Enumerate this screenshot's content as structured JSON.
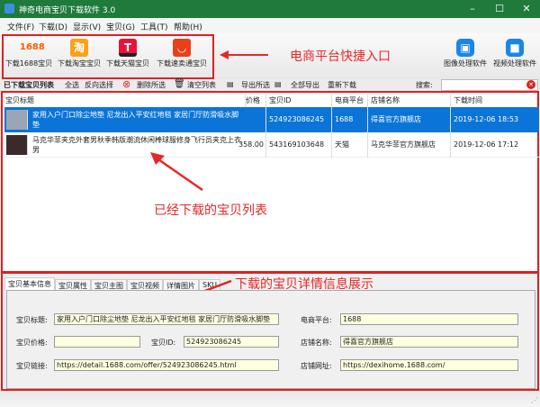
{
  "window": {
    "title": "神奇电商宝贝下载软件 3.0"
  },
  "menu": [
    "文件(F)",
    "下载(D)",
    "显示(V)",
    "宝贝(G)",
    "工具(T)",
    "帮助(H)"
  ],
  "toolbar": {
    "buttons": [
      {
        "label": "下载1688宝贝",
        "icon_text": "1688"
      },
      {
        "label": "下载淘宝宝贝",
        "icon_text": "淘"
      },
      {
        "label": "下载天猫宝贝",
        "icon_text": "T"
      },
      {
        "label": "下载速卖通宝贝",
        "icon_text": "◡"
      }
    ],
    "right_buttons": [
      {
        "label": "图像处理软件"
      },
      {
        "label": "视频处理软件"
      }
    ],
    "annotation": "电商平台快捷入口"
  },
  "toolbar2": {
    "title": "已下载宝贝列表",
    "select_all": "全选",
    "invert": "反向选择",
    "delete": "删除所选",
    "clear": "清空列表",
    "export_sel": "导出所选",
    "export_all": "全部导出",
    "redownload": "重新下载",
    "search_label": "搜索:",
    "search_value": ""
  },
  "list": {
    "columns": [
      "宝贝标题",
      "价格",
      "宝贝ID",
      "电商平台",
      "店铺名称",
      "下载时间"
    ],
    "rows": [
      {
        "title": "家用入户门口除尘地垫 尼龙出入平安红地毯 家居门厅防滑吸水脚垫",
        "price": "",
        "id": "524923086245",
        "platform": "1688",
        "shop": "得喜官方旗舰店",
        "time": "2019-12-06 18:53",
        "selected": true
      },
      {
        "title": "马克华菲夹克外套男秋季韩版潮流休闲棒球服修身飞行员夹克上衣男",
        "price": "358.00",
        "id": "543169103648",
        "platform": "天猫",
        "shop": "马克华菲官方旗舰店",
        "time": "2019-12-06 17:12",
        "selected": false
      }
    ],
    "annotation": "已经下载的宝贝列表"
  },
  "detail": {
    "tabs": [
      "宝贝基本信息",
      "宝贝属性",
      "宝贝主图",
      "宝贝视频",
      "详情图片",
      "SKU"
    ],
    "annotation": "下载的宝贝详情信息展示",
    "fields": {
      "title_label": "宝贝标题:",
      "title": "家用入户门口除尘地垫 尼龙出入平安红地毯 家居门厅防滑吸水脚垫",
      "price_label": "宝贝价格:",
      "price": "",
      "id_label": "宝贝ID:",
      "id": "524923086245",
      "link_label": "宝贝链接:",
      "link": "https://detail.1688.com/offer/524923086245.html",
      "platform_label": "电商平台:",
      "platform": "1688",
      "shop_label": "店铺名称:",
      "shop": "得喜官方旗舰店",
      "url_label": "店铺网址:",
      "url": "https://dexihome.1688.com/"
    }
  },
  "colors": {
    "accent": "#0a74d8",
    "annotation": "#e62828",
    "titlebar": "#1f7a3c"
  }
}
